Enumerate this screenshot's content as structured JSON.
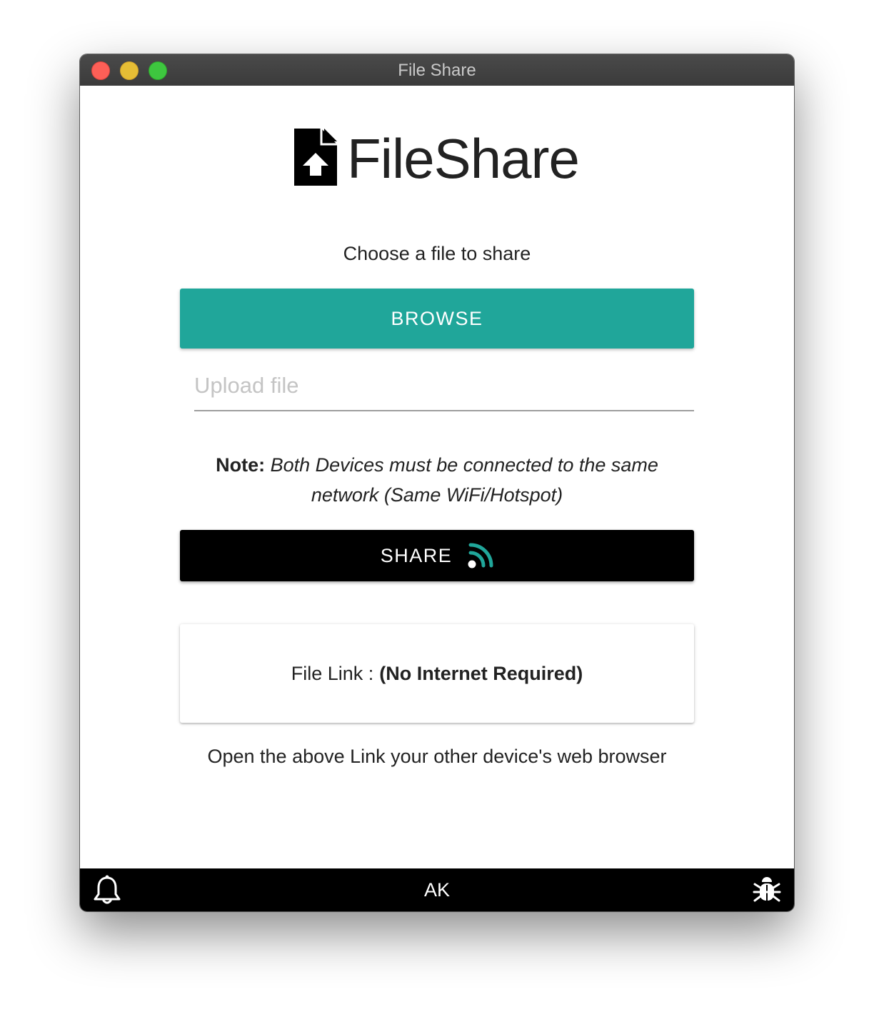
{
  "window": {
    "title": "File Share"
  },
  "logo": {
    "text": "FileShare",
    "icon": "file-upload-icon"
  },
  "choose_text": "Choose a file to share",
  "browse": {
    "label": "BROWSE",
    "color": "#20a69a"
  },
  "upload": {
    "placeholder": "Upload file",
    "value": ""
  },
  "note": {
    "label": "Note:",
    "text": "Both Devices must be connected to the same network (Same WiFi/Hotspot)"
  },
  "share": {
    "label": "SHARE",
    "icon": "rss-icon",
    "icon_color": "#20a69a"
  },
  "file_link": {
    "label": "File Link :",
    "value": "(No Internet Required)"
  },
  "open_text": "Open the above Link your other device's web browser",
  "footer": {
    "left_icon": "bell-icon",
    "center": "AK",
    "right_icon": "bug-icon"
  }
}
